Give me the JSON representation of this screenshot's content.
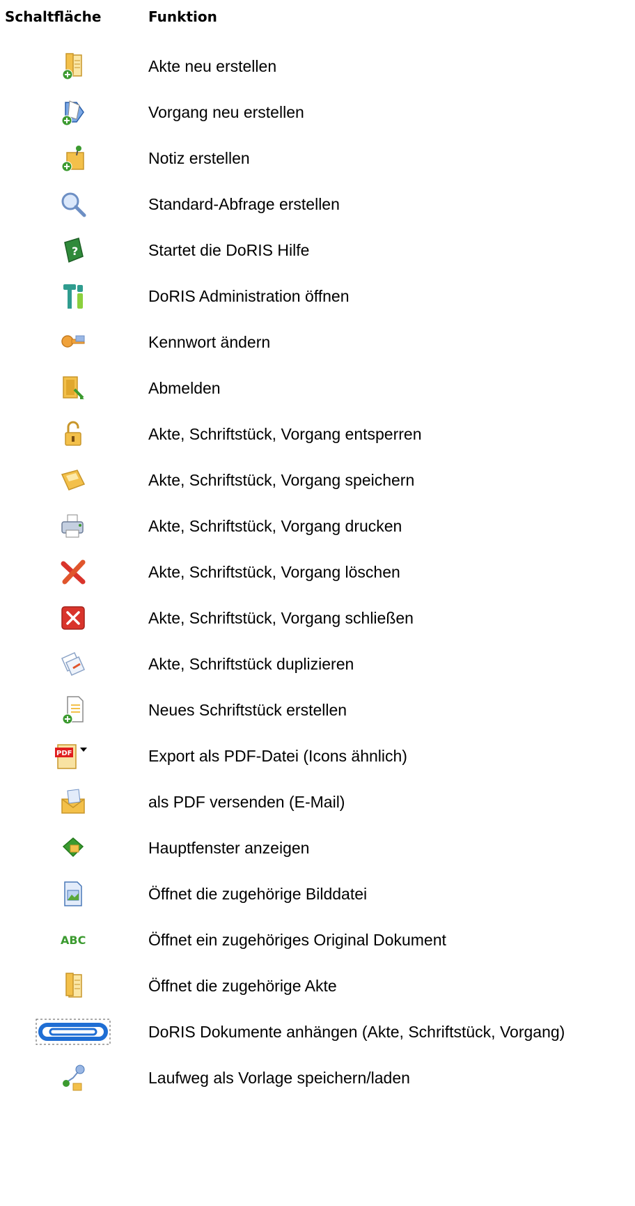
{
  "header": {
    "col_button": "Schaltfläche",
    "col_function": "Funktion"
  },
  "rows": [
    {
      "icon": "file-new-icon",
      "label": "Akte neu erstellen"
    },
    {
      "icon": "process-new-icon",
      "label": "Vorgang neu erstellen"
    },
    {
      "icon": "note-new-icon",
      "label": "Notiz erstellen"
    },
    {
      "icon": "magnifier-icon",
      "label": "Standard-Abfrage erstellen"
    },
    {
      "icon": "help-book-icon",
      "label": "Startet die DoRIS Hilfe"
    },
    {
      "icon": "admin-tools-icon",
      "label": "DoRIS Administration öffnen"
    },
    {
      "icon": "keys-icon",
      "label": "Kennwort ändern"
    },
    {
      "icon": "logout-door-icon",
      "label": "Abmelden"
    },
    {
      "icon": "unlock-icon",
      "label": "Akte, Schriftstück, Vorgang entsperren"
    },
    {
      "icon": "save-icon",
      "label": "Akte, Schriftstück, Vorgang speichern"
    },
    {
      "icon": "printer-icon",
      "label": "Akte, Schriftstück, Vorgang drucken"
    },
    {
      "icon": "delete-x-icon",
      "label": "Akte, Schriftstück, Vorgang löschen"
    },
    {
      "icon": "close-box-icon",
      "label": "Akte, Schriftstück, Vorgang schließen"
    },
    {
      "icon": "duplicate-icon",
      "label": "Akte, Schriftstück duplizieren"
    },
    {
      "icon": "document-new-icon",
      "label": "Neues Schriftstück erstellen"
    },
    {
      "icon": "pdf-export-icon",
      "icon_text": "PDF",
      "label": "Export als PDF-Datei (Icons ähnlich)"
    },
    {
      "icon": "mail-pdf-icon",
      "label": "als PDF versenden (E-Mail)"
    },
    {
      "icon": "home-window-icon",
      "label": "Hauptfenster anzeigen"
    },
    {
      "icon": "image-file-icon",
      "label": "Öffnet die zugehörige Bilddatei"
    },
    {
      "icon": "abc-original-icon",
      "icon_text": "ABC",
      "label": "Öffnet ein zugehöriges Original Dokument"
    },
    {
      "icon": "file-folder-icon",
      "label": "Öffnet die zugehörige Akte"
    },
    {
      "icon": "paperclip-icon",
      "label": "DoRIS Dokumente anhängen (Akte, Schriftstück, Vorgang)"
    },
    {
      "icon": "route-template-icon",
      "label": "Laufweg als Vorlage speichern/laden"
    }
  ],
  "colors": {
    "folder": "#f3c04a",
    "green": "#3b9a2f",
    "red": "#d9342b",
    "blue": "#2a78d6"
  }
}
